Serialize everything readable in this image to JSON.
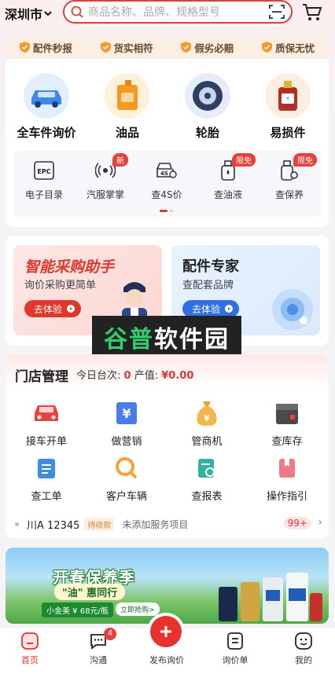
{
  "header": {
    "city": "深圳市",
    "search_placeholder": "商品名称、品牌、规格型号"
  },
  "guarantees": [
    "配件秒报",
    "货实相符",
    "假劣必赔",
    "质保无忧"
  ],
  "categories": [
    {
      "label": "全车件询价",
      "icon": "car-icon"
    },
    {
      "label": "油品",
      "icon": "oil-can-icon"
    },
    {
      "label": "轮胎",
      "icon": "tire-icon"
    },
    {
      "label": "易损件",
      "icon": "antifreeze-bottle-icon"
    }
  ],
  "sub_items": [
    {
      "label": "电子目录",
      "icon": "epc-icon",
      "badge": ""
    },
    {
      "label": "汽服掌掌",
      "icon": "radar-icon",
      "badge": "新"
    },
    {
      "label": "查4S价",
      "icon": "4s-icon",
      "badge": ""
    },
    {
      "label": "查油液",
      "icon": "fluid-bottle-icon",
      "badge": "限免"
    },
    {
      "label": "查保养",
      "icon": "maintenance-icon",
      "badge": "限免"
    }
  ],
  "promo": {
    "assistant": {
      "title": "智能采购助手",
      "subtitle": "询价采购更简单",
      "button": "去体验"
    },
    "expert": {
      "title": "配件专家",
      "subtitle": "查配套品牌",
      "button": "去体验"
    }
  },
  "watermark": {
    "part1": "谷普",
    "part2": "软件园"
  },
  "store": {
    "title": "门店管理",
    "today_label": "今日台次:",
    "today_value": "0",
    "revenue_label": "产值:",
    "revenue_value": "¥0.00",
    "tools": [
      {
        "label": "接车开单",
        "icon": "car-front-icon"
      },
      {
        "label": "做营销",
        "icon": "voucher-icon"
      },
      {
        "label": "管商机",
        "icon": "money-bag-icon"
      },
      {
        "label": "查库存",
        "icon": "box-icon"
      },
      {
        "label": "查工单",
        "icon": "clipboard-icon"
      },
      {
        "label": "客户车辆",
        "icon": "search-car-icon"
      },
      {
        "label": "查报表",
        "icon": "report-icon"
      },
      {
        "label": "操作指引",
        "icon": "guide-book-icon"
      }
    ],
    "recent": {
      "plate": "川A 12345",
      "status": "待收款",
      "note": "未添加服务项目",
      "count": "99+"
    }
  },
  "banner": {
    "title": "开春保养季",
    "subtitle": "\"油\" 惠同行",
    "price": "小金美 ¥ 68元/瓶",
    "cta": "立即抢购>"
  },
  "nav": [
    {
      "label": "首页",
      "icon": "home-icon",
      "active": true
    },
    {
      "label": "沟通",
      "icon": "chat-icon",
      "badge": "4"
    },
    {
      "label": "发布询价",
      "icon": "plus-icon"
    },
    {
      "label": "询价单",
      "icon": "list-doc-icon"
    },
    {
      "label": "我的",
      "icon": "profile-icon"
    }
  ],
  "colors": {
    "accent": "#e0362c",
    "brand_blue": "#2f6fe0"
  }
}
